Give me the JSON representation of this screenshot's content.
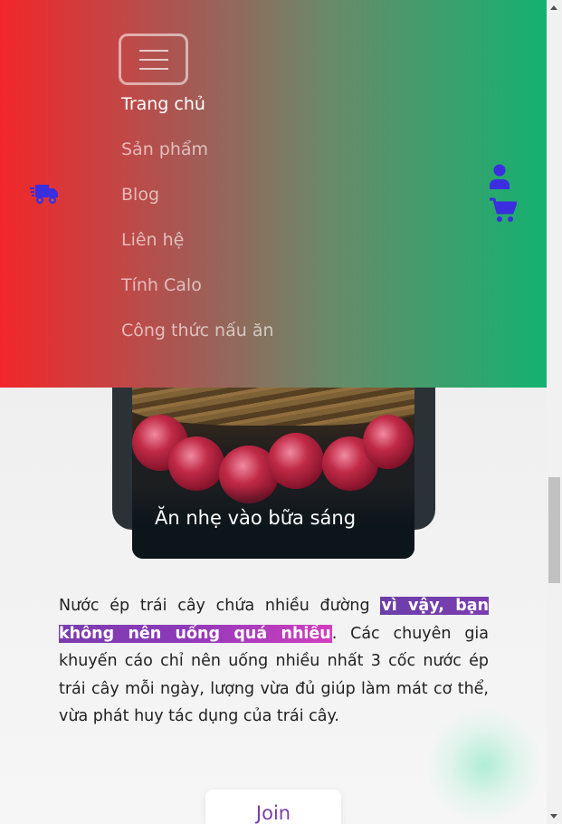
{
  "header": {
    "menu_button_icon": "hamburger-icon",
    "nav_items": [
      {
        "label": "Trang chủ",
        "active": true
      },
      {
        "label": "Sản phẩm",
        "active": false
      },
      {
        "label": "Blog",
        "active": false
      },
      {
        "label": "Liên hệ",
        "active": false
      },
      {
        "label": "Tính Calo",
        "active": false
      },
      {
        "label": "Công thức nấu ăn",
        "active": false
      }
    ],
    "left_icon": "delivery-truck-icon",
    "right_icons": [
      "user-icon",
      "cart-icon"
    ],
    "icon_color": "#3b2de0",
    "gradient_colors": [
      "#f2262a",
      "#13b270"
    ]
  },
  "card": {
    "title": "Ăn nhẹ vào bữa sáng"
  },
  "article": {
    "text_before": "Nước ép trái cây chứa nhiều đường ",
    "highlight": "vì vậy, bạn không nên uống quá nhiều",
    "text_after": ". Các chuyên gia khuyến cáo chỉ nên uống nhiều nhất 3 cốc nước ép trái cây mỗi ngày, lượng vừa đủ giúp làm mát cơ thể, vừa phát huy tác dụng của trái cây.",
    "highlight_colors": [
      "#6b3fa8",
      "#d23fc0"
    ]
  },
  "join_button": {
    "label": "Join",
    "color": "#7a3fa3"
  }
}
